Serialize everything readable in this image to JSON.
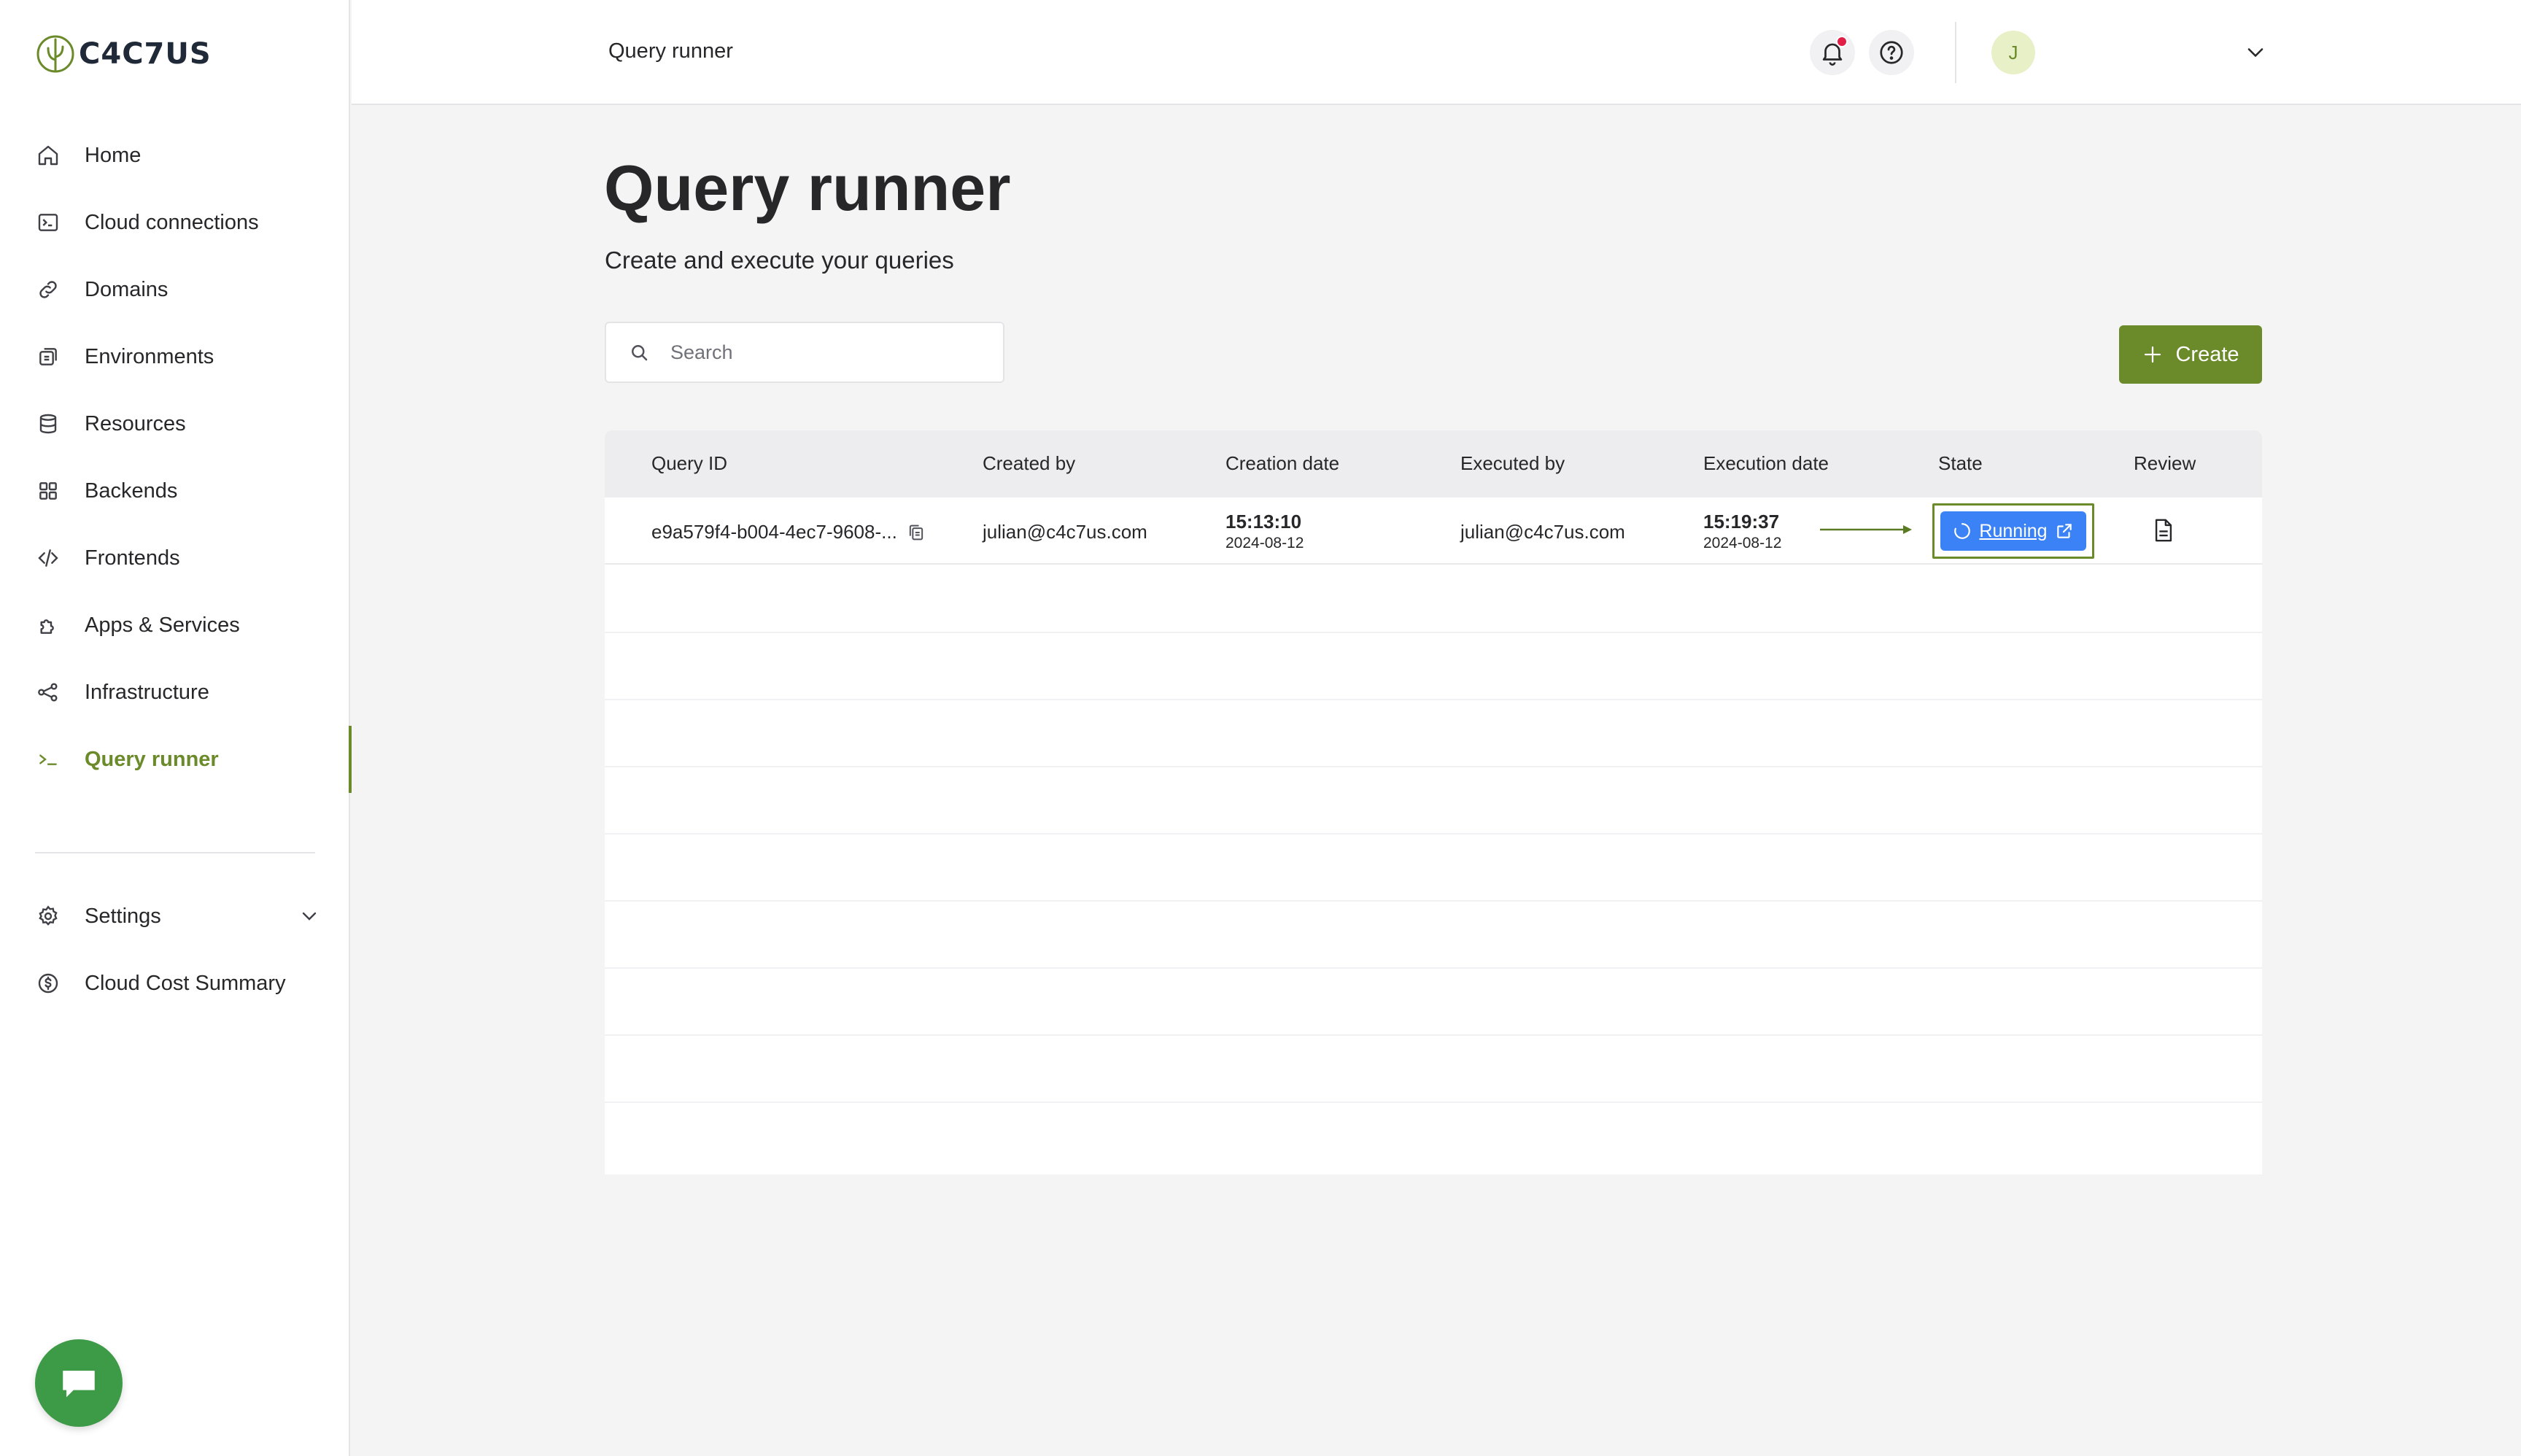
{
  "app": {
    "logo_text": "C4C7US",
    "brand_color": "#6b8a2a"
  },
  "sidebar": {
    "items": [
      {
        "label": "Home",
        "icon": "home-icon"
      },
      {
        "label": "Cloud connections",
        "icon": "terminal-box-icon"
      },
      {
        "label": "Domains",
        "icon": "link-icon"
      },
      {
        "label": "Environments",
        "icon": "environments-icon"
      },
      {
        "label": "Resources",
        "icon": "database-icon"
      },
      {
        "label": "Backends",
        "icon": "grid-icon"
      },
      {
        "label": "Frontends",
        "icon": "code-icon"
      },
      {
        "label": "Apps & Services",
        "icon": "puzzle-icon"
      },
      {
        "label": "Infrastructure",
        "icon": "share-nodes-icon"
      },
      {
        "label": "Query runner",
        "icon": "terminal-prompt-icon",
        "active": true
      }
    ],
    "bottom_items": [
      {
        "label": "Settings",
        "icon": "gear-icon"
      },
      {
        "label": "Cloud Cost Summary",
        "icon": "dollar-circle-icon"
      }
    ]
  },
  "topbar": {
    "title": "Query runner",
    "avatar_initial": "J"
  },
  "page": {
    "title": "Query runner",
    "subtitle": "Create and execute your queries"
  },
  "search": {
    "placeholder": "Search",
    "value": ""
  },
  "create_button": {
    "label": "Create"
  },
  "table": {
    "columns": [
      "Query ID",
      "Created by",
      "Creation date",
      "Executed by",
      "Execution date",
      "State",
      "Review"
    ],
    "rows": [
      {
        "query_id": "e9a579f4-b004-4ec7-9608-...",
        "created_by": "julian@c4c7us.com",
        "creation_time": "15:13:10",
        "creation_date": "2024-08-12",
        "executed_by": "julian@c4c7us.com",
        "execution_time": "15:19:37",
        "execution_date": "2024-08-12",
        "state": "Running",
        "state_color": "#3b82f6"
      }
    ]
  }
}
